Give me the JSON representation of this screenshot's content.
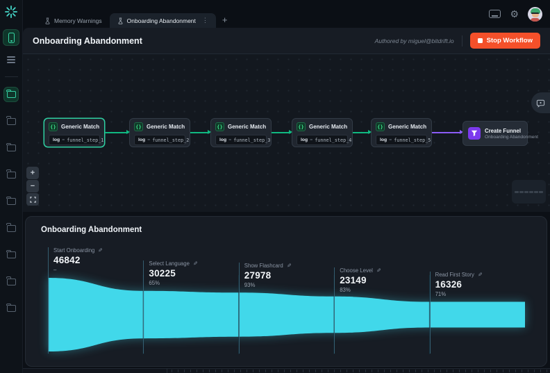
{
  "topbar": {
    "tabs": [
      {
        "label": "Memory Warnings",
        "active": false
      },
      {
        "label": "Onboarding Abandonment",
        "active": true
      }
    ],
    "new_tab_label": "+"
  },
  "header": {
    "title": "Onboarding Abandonment",
    "authored_by": "Authored by miguel@bitdrift.io",
    "stop_button_label": "Stop Workflow"
  },
  "workflow": {
    "nodes": [
      {
        "title": "Generic Match",
        "condition_key": "log",
        "condition_op": "=",
        "condition_value": "funnel_step_1",
        "selected": true
      },
      {
        "title": "Generic Match",
        "condition_key": "log",
        "condition_op": "=",
        "condition_value": "funnel_step_2",
        "selected": false
      },
      {
        "title": "Generic Match",
        "condition_key": "log",
        "condition_op": "=",
        "condition_value": "funnel_step_3",
        "selected": false
      },
      {
        "title": "Generic Match",
        "condition_key": "log",
        "condition_op": "=",
        "condition_value": "funnel_step_4",
        "selected": false
      },
      {
        "title": "Generic Match",
        "condition_key": "log",
        "condition_op": "=",
        "condition_value": "funnel_step_5",
        "selected": false
      }
    ],
    "output_node": {
      "title": "Create Funnel",
      "subtitle": "Onboarding Abandonment"
    }
  },
  "funnel_panel": {
    "title": "Onboarding Abandonment"
  },
  "chart_data": {
    "type": "area",
    "title": "Onboarding Abandonment",
    "stages": [
      {
        "label": "Start Onboarding",
        "value": 46842,
        "pct_label": "–"
      },
      {
        "label": "Select Language",
        "value": 30225,
        "pct_label": "65%"
      },
      {
        "label": "Show Flashcard",
        "value": 27978,
        "pct_label": "93%"
      },
      {
        "label": "Choose Level",
        "value": 23149,
        "pct_label": "83%"
      },
      {
        "label": "Read First Story",
        "value": 16326,
        "pct_label": "71%"
      }
    ],
    "color": "#41d8ea",
    "legend": "none",
    "grid": "off"
  },
  "icons": {
    "node_match_glyph": "{}",
    "kebab": "⋮",
    "gear": "⚙",
    "edit": "✎",
    "zoom_in": "+",
    "zoom_out": "−"
  },
  "colors": {
    "edge_green": "#10b981",
    "edge_purple": "#8b5cf6",
    "accent_teal": "#35d0a4",
    "stop_orange": "#f4502a",
    "funnel_cyan": "#41d8ea",
    "output_purple": "#7c3aed"
  }
}
